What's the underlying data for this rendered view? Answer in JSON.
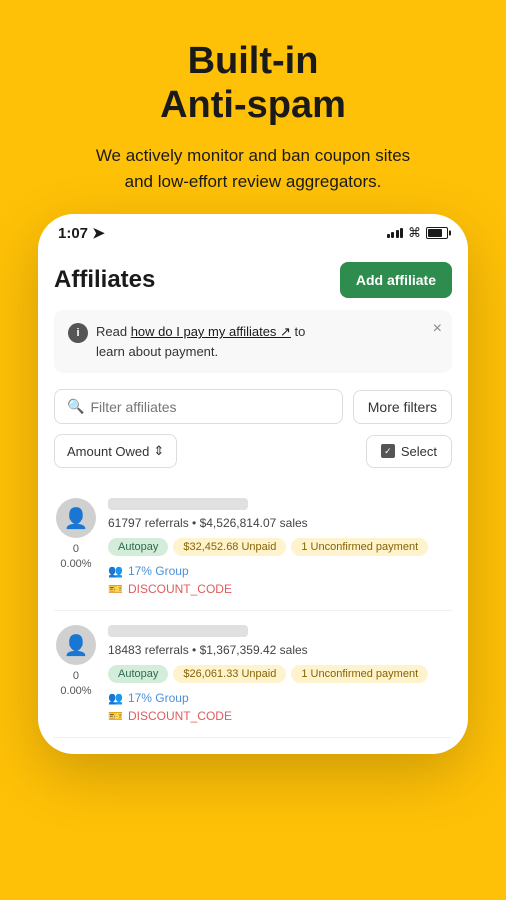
{
  "hero": {
    "title": "Built-in\nAnti-spam",
    "subtitle": "We actively monitor and ban coupon sites\nand low-effort review aggregators."
  },
  "phone": {
    "statusBar": {
      "time": "1:07",
      "timeIcon": "→"
    },
    "header": {
      "title": "Affiliates",
      "addButton": "Add affiliate"
    },
    "infoBanner": {
      "text": "Read ",
      "linkText": "how do I pay my affiliates",
      "textAfter": " to\nlearn about payment."
    },
    "filters": {
      "searchPlaceholder": "Filter affiliates",
      "moreFilters": "More filters",
      "sortLabel": "Amount Owed",
      "selectLabel": "Select"
    },
    "affiliates": [
      {
        "count": "0",
        "percent": "0.00%",
        "stats": "61797 referrals • $4,526,814.07 sales",
        "tags": [
          "Autopay",
          "$32,452.68 Unpaid",
          "1 Unconfirmed payment"
        ],
        "group": "17% Group",
        "discount": "DISCOUNT_CODE"
      },
      {
        "count": "0",
        "percent": "0.00%",
        "stats": "18483 referrals • $1,367,359.42 sales",
        "tags": [
          "Autopay",
          "$26,061.33 Unpaid",
          "1 Unconfirmed payment"
        ],
        "group": "17% Group",
        "discount": "DISCOUNT_CODE"
      }
    ]
  }
}
